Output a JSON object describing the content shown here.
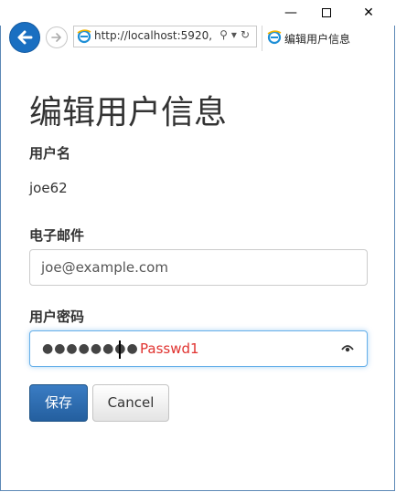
{
  "browser": {
    "address": "http://localhost:5920,",
    "tab_title": "编辑用户信息"
  },
  "window_controls": {
    "minimize": "—",
    "close": "✕"
  },
  "page": {
    "title": "编辑用户信息",
    "username_label": "用户名",
    "username_value": "joe62",
    "email_label": "电子邮件",
    "email_value": "joe@example.com",
    "password_label": "用户密码",
    "password_mask": "●●●●●●●●",
    "password_hint": "Passwd1",
    "save_label": "保存",
    "cancel_label": "Cancel"
  },
  "icons": [
    "back-arrow-icon",
    "forward-arrow-icon",
    "ie-icon",
    "search-icon",
    "refresh-icon",
    "reveal-password-icon"
  ],
  "colors": {
    "accent": "#2a6ab0",
    "hint": "#e0322f",
    "focus": "#66afe9"
  }
}
